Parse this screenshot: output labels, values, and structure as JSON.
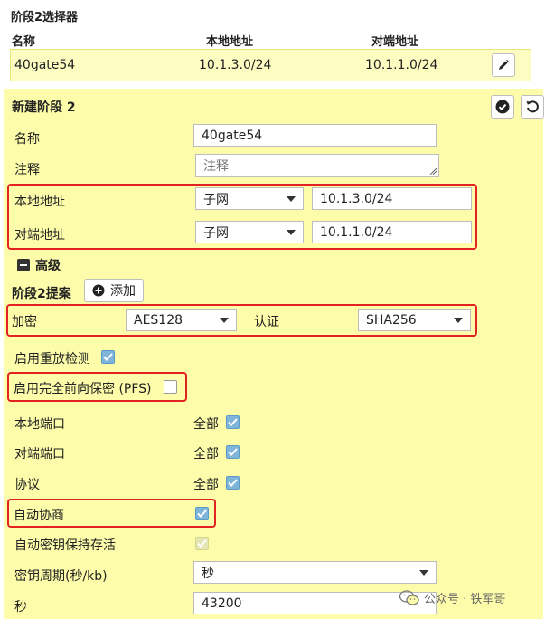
{
  "selector": {
    "title": "阶段2选择器",
    "columns": [
      "名称",
      "本地地址",
      "对端地址"
    ],
    "row": {
      "name": "40gate54",
      "local": "10.1.3.0/24",
      "remote": "10.1.1.0/24"
    }
  },
  "phase2": {
    "title": "新建阶段 2",
    "name_label": "名称",
    "name_value": "40gate54",
    "comment_label": "注释",
    "comment_placeholder": "注释",
    "local_label": "本地地址",
    "local_type": "子网",
    "local_value": "10.1.3.0/24",
    "remote_label": "对端地址",
    "remote_type": "子网",
    "remote_value": "10.1.1.0/24",
    "advanced_label": "高级",
    "proposal_label": "阶段2提案",
    "add_label": "添加",
    "encryption_label": "加密",
    "encryption_value": "AES128",
    "auth_label": "认证",
    "auth_value": "SHA256",
    "replay_label": "启用重放检测",
    "replay_checked": true,
    "pfs_label": "启用完全前向保密 (PFS)",
    "pfs_checked": false,
    "local_port_label": "本地端口",
    "remote_port_label": "对端端口",
    "protocol_label": "协议",
    "all_label": "全部",
    "auto_negotiate_label": "自动协商",
    "auto_negotiate_checked": true,
    "autokey_keepalive_label": "自动密钥保持存活",
    "key_lifetime_label": "密钥周期(秒/kb)",
    "key_lifetime_value": "秒",
    "seconds_label": "秒",
    "seconds_value": "43200"
  },
  "watermark": {
    "text": "公众号 · 铁军哥"
  },
  "colors": {
    "panel": "#fcfcaa",
    "highlight_border": "#e32222",
    "checkbox": "#7fb5d8"
  },
  "icons": [
    "pencil-icon",
    "check-circle-icon",
    "undo-icon",
    "plus-circle-icon",
    "minus-square-icon",
    "wechat-icon"
  ]
}
